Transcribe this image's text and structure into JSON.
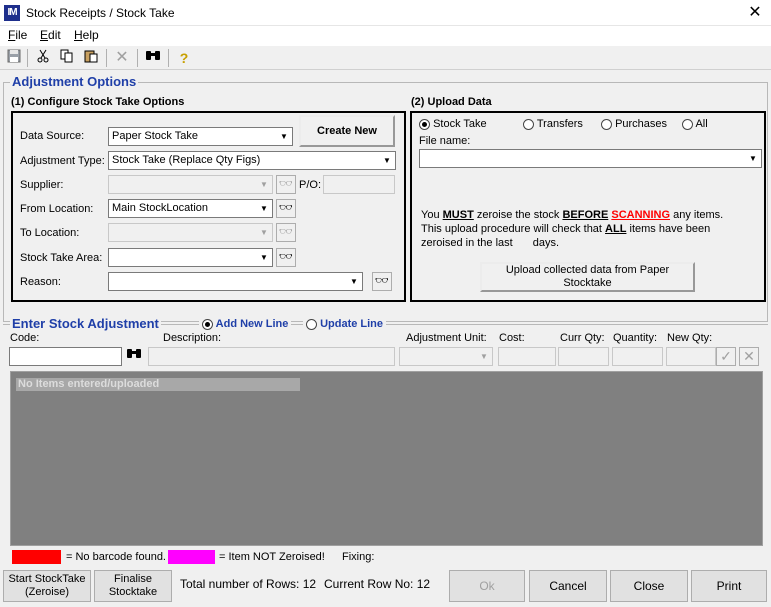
{
  "window": {
    "app_icon_text": "IM",
    "title": "Stock Receipts / Stock Take",
    "close_glyph": "✕"
  },
  "menu": [
    {
      "label": "File",
      "accel": "F",
      "rest": "ile"
    },
    {
      "label": "Edit",
      "accel": "E",
      "rest": "dit"
    },
    {
      "label": "Help",
      "accel": "H",
      "rest": "elp"
    }
  ],
  "toolbar": {
    "icons": [
      "save-icon",
      "cut-icon",
      "copy-icon",
      "paste-icon",
      "delete-icon",
      "find-icon",
      "help-icon"
    ]
  },
  "adjustment_options": {
    "legend": "Adjustment Options",
    "configure": {
      "heading": "(1) Configure Stock Take Options",
      "data_source_label": "Data Source:",
      "data_source_value": "Paper Stock Take",
      "create_new_label": "Create New",
      "adjustment_type_label": "Adjustment Type:",
      "adjustment_type_value": "Stock Take (Replace Qty Figs)",
      "supplier_label": "Supplier:",
      "supplier_value": "",
      "po_label": "P/O:",
      "po_value": "",
      "from_location_label": "From Location:",
      "from_location_value": "Main StockLocation",
      "to_location_label": "To  Location:",
      "to_location_value": "",
      "stock_take_area_label": "Stock Take Area:",
      "stock_take_area_value": "",
      "reason_label": "Reason:",
      "reason_value": ""
    },
    "upload": {
      "heading": "(2) Upload Data",
      "radios": [
        {
          "label": "Stock Take",
          "selected": true
        },
        {
          "label": "Transfers",
          "selected": false
        },
        {
          "label": "Purchases",
          "selected": false
        },
        {
          "label": "All",
          "selected": false
        }
      ],
      "file_name_label": "File name:",
      "file_name_value": "",
      "warn_you": "You ",
      "warn_must": "MUST",
      "warn_zeroise": " zeroise the stock ",
      "warn_before": "BEFORE",
      "warn_scanning": "SCANNING",
      "warn_any_items": " any items.",
      "warn_line2_a": "This upload procedure will check that ",
      "warn_all": "ALL",
      "warn_line2_b": " items have been",
      "warn_line3_a": "zeroised in the last",
      "warn_line3_b": "days.",
      "upload_button": "Upload collected data from Paper Stocktake"
    }
  },
  "enter_adjustment": {
    "legend": "Enter Stock Adjustment",
    "mode_radios": [
      {
        "label": "Add New Line",
        "selected": true
      },
      {
        "label": "Update Line",
        "selected": false
      }
    ],
    "columns": {
      "code": "Code:",
      "description": "Description:",
      "adjustment_unit": "Adjustment Unit:",
      "cost": "Cost:",
      "curr_qty": "Curr Qty:",
      "quantity": "Quantity:",
      "new_qty": "New Qty:"
    },
    "code_value": "",
    "empty_message": "No Items entered/uploaded"
  },
  "legend_bar": {
    "red_label": "= No barcode found.",
    "magenta_label": "= Item NOT Zeroised!",
    "fixing_label": "Fixing:",
    "red_color": "#ff0000",
    "magenta_color": "#ff00ff"
  },
  "footer": {
    "start_stocktake": [
      "Start StockTake",
      "(Zeroise)"
    ],
    "finalise_stocktake": [
      "Finalise",
      "Stocktake"
    ],
    "total_rows_label": "Total number of Rows:",
    "total_rows_value": "12",
    "current_row_label": "Current Row No:",
    "current_row_value": "12",
    "ok_label": "Ok",
    "cancel_label": "Cancel",
    "close_label": "Close",
    "print_label": "Print"
  }
}
